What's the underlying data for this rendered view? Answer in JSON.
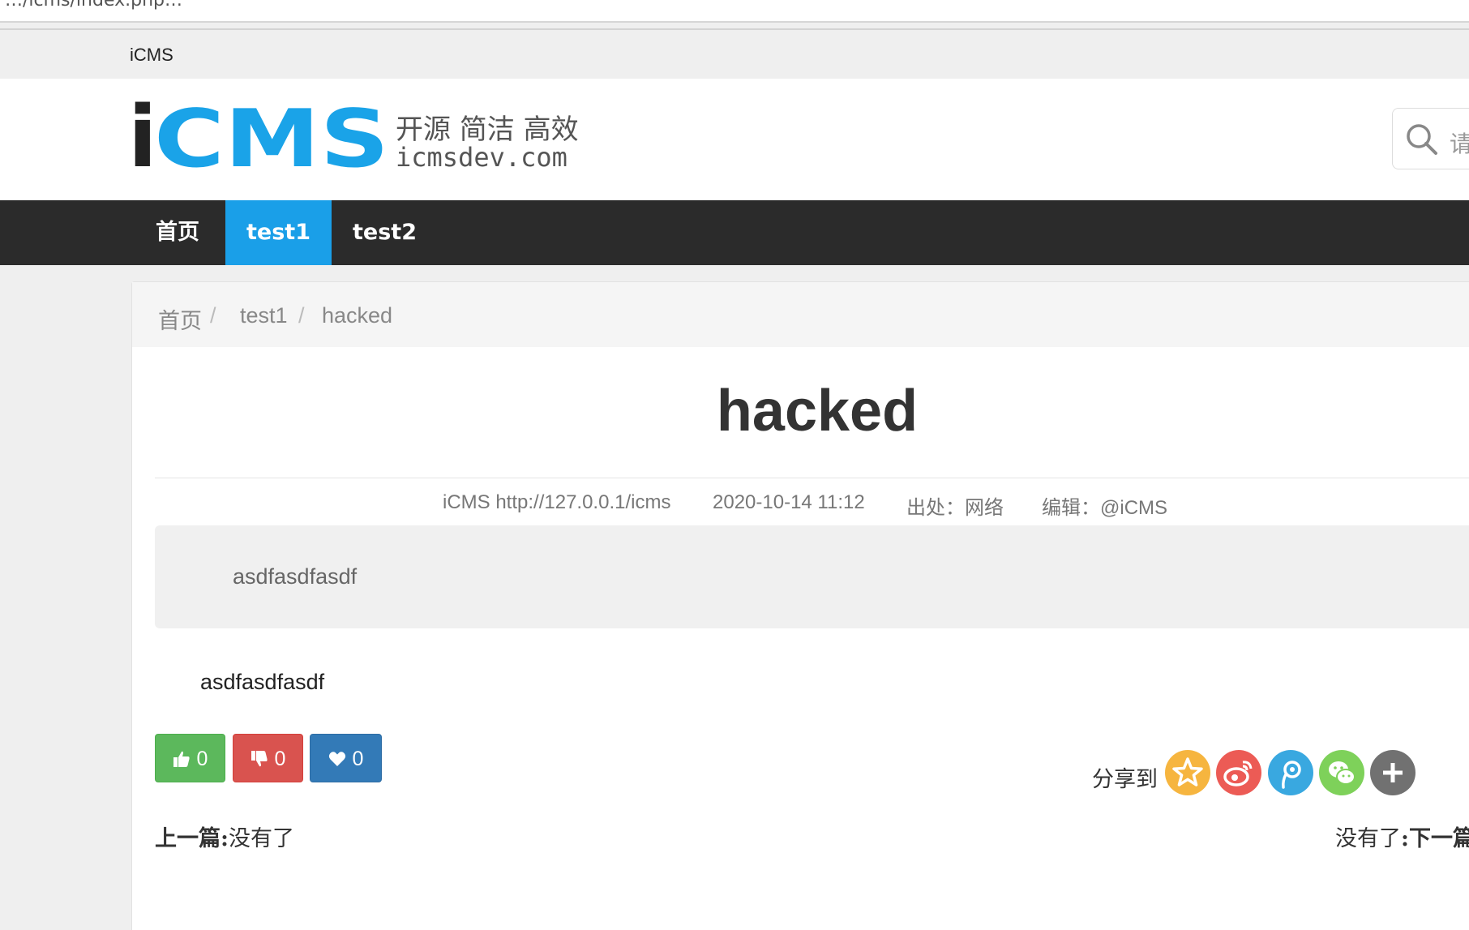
{
  "browser": {
    "address_fragment": "…/icms/index.php…"
  },
  "topbar": {
    "brand": "iCMS"
  },
  "header": {
    "logo_text": "iCMS",
    "logo_tagline": "开源 简洁 高效",
    "logo_domain": "icmsdev.com",
    "search_placeholder": "请"
  },
  "nav": {
    "items": [
      {
        "label": "首页"
      },
      {
        "label": "test1",
        "active": true
      },
      {
        "label": "test2"
      }
    ]
  },
  "breadcrumb": {
    "items": [
      "首页",
      "test1",
      "hacked"
    ],
    "separator": "/"
  },
  "article": {
    "title": "hacked",
    "meta": {
      "site": "iCMS http://127.0.0.1/icms",
      "date": "2020-10-14 11:12",
      "source": "出处：网络",
      "editor": "编辑：@iCMS"
    },
    "summary": "asdfasdfasdf",
    "body": "asdfasdfasdf"
  },
  "actions": {
    "like_count": "0",
    "dislike_count": "0",
    "favorite_count": "0"
  },
  "share": {
    "label": "分享到",
    "targets": [
      {
        "name": "qzone",
        "color": "#f6b53f"
      },
      {
        "name": "weibo",
        "color": "#ec5b55"
      },
      {
        "name": "tencent-weibo",
        "color": "#39a8e0"
      },
      {
        "name": "wechat",
        "color": "#7ed15a"
      },
      {
        "name": "more",
        "color": "#717171"
      }
    ]
  },
  "pager": {
    "prev_label": "上一篇",
    "prev_value": "没有了",
    "next_value": "没有了",
    "next_label": "下一篇"
  }
}
